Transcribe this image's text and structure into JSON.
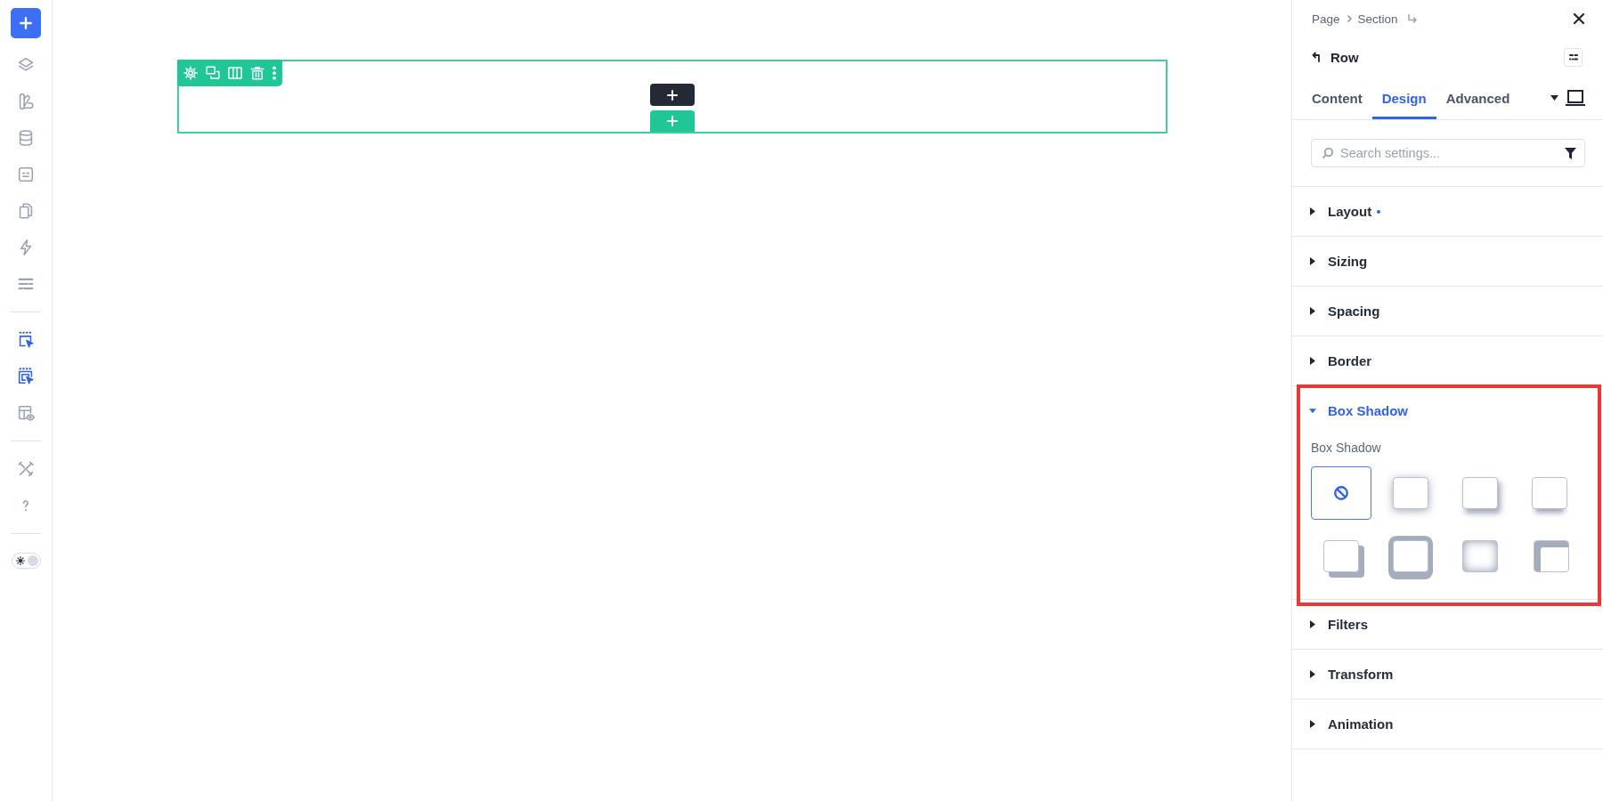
{
  "sidebar": {
    "groups": [
      {
        "items": [
          {
            "kind": "layers",
            "active": false
          },
          {
            "kind": "swatches",
            "active": false
          },
          {
            "kind": "database",
            "active": false
          },
          {
            "kind": "card",
            "active": false
          },
          {
            "kind": "pages",
            "active": false
          },
          {
            "kind": "lightning",
            "active": false
          },
          {
            "kind": "rows",
            "active": false
          }
        ]
      },
      {
        "items": [
          {
            "kind": "click",
            "active": true
          },
          {
            "kind": "hover",
            "active": true
          },
          {
            "kind": "preview",
            "active": false
          }
        ]
      },
      {
        "items": [
          {
            "kind": "tools",
            "active": false
          },
          {
            "kind": "help",
            "active": false
          }
        ]
      }
    ],
    "theme_toggle": {
      "on": true
    }
  },
  "canvas": {
    "row": {
      "selected": true
    }
  },
  "settings": {
    "breadcrumb": [
      "Page",
      "Section"
    ],
    "title": "Row",
    "tabs": [
      {
        "label": "Content",
        "selected": false
      },
      {
        "label": "Design",
        "selected": true
      },
      {
        "label": "Advanced",
        "selected": false
      }
    ],
    "search": {
      "placeholder": "Search settings..."
    },
    "sections": [
      {
        "label": "Layout",
        "expanded": false,
        "modified": true,
        "highlighted": false
      },
      {
        "label": "Sizing",
        "expanded": false,
        "modified": false,
        "highlighted": false
      },
      {
        "label": "Spacing",
        "expanded": false,
        "modified": false,
        "highlighted": false
      },
      {
        "label": "Border",
        "expanded": false,
        "modified": false,
        "highlighted": false
      },
      {
        "label": "Box Shadow",
        "expanded": true,
        "modified": false,
        "highlighted": true,
        "field_label": "Box Shadow",
        "options": [
          {
            "kind": "none",
            "selected": true
          },
          {
            "kind": "soft",
            "selected": false
          },
          {
            "kind": "offset",
            "selected": false
          },
          {
            "kind": "bottom",
            "selected": false
          },
          {
            "kind": "hard",
            "selected": false
          },
          {
            "kind": "thick",
            "selected": false
          },
          {
            "kind": "inset",
            "selected": false
          },
          {
            "kind": "corner",
            "selected": false
          }
        ]
      },
      {
        "label": "Filters",
        "expanded": false,
        "modified": false,
        "highlighted": false
      },
      {
        "label": "Transform",
        "expanded": false,
        "modified": false,
        "highlighted": false
      },
      {
        "label": "Animation",
        "expanded": false,
        "modified": false,
        "highlighted": false
      }
    ]
  }
}
